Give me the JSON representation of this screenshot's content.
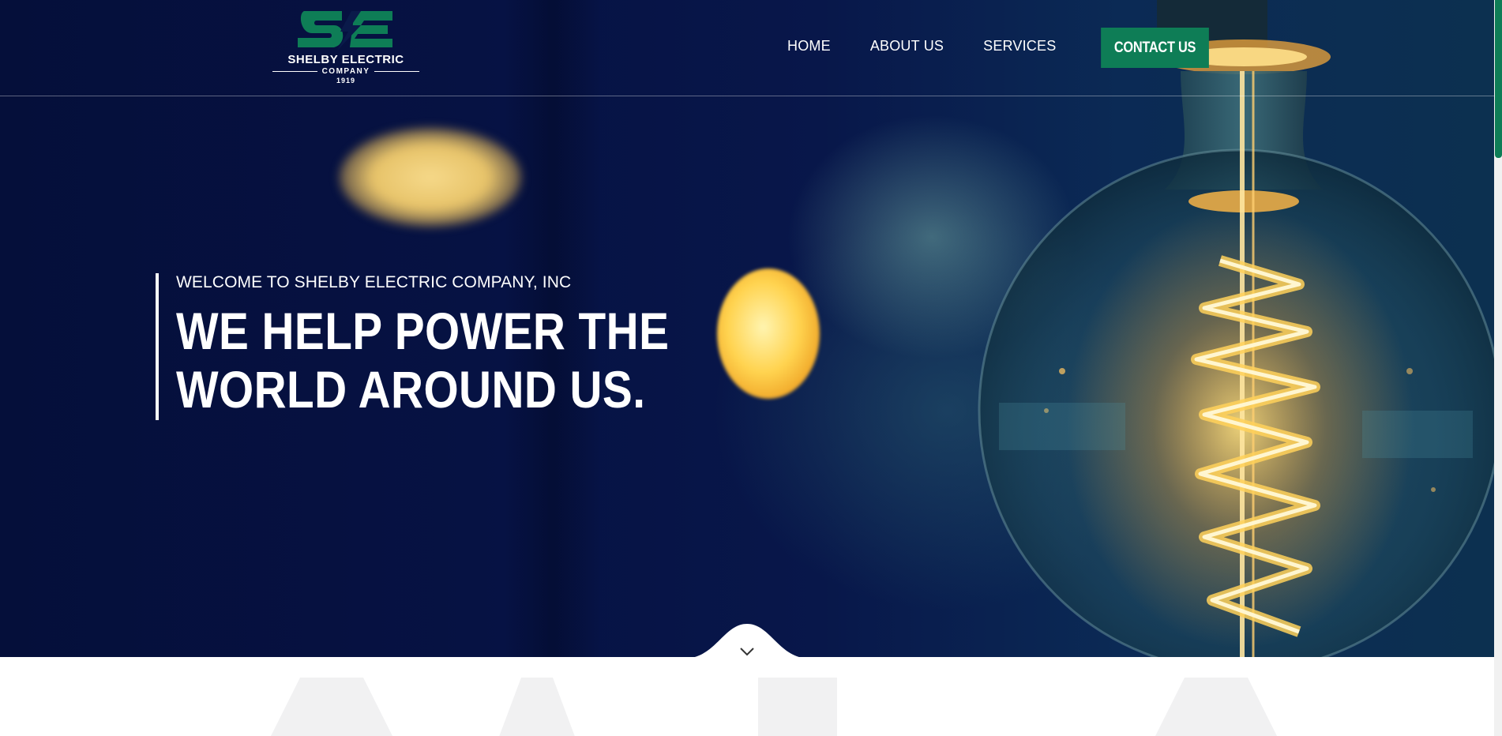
{
  "brand": {
    "logo_name": "SHELBY ELECTRIC",
    "logo_sub": "COMPANY",
    "logo_year": "1919",
    "accent_color": "#0e7d56"
  },
  "nav": {
    "items": [
      "HOME",
      "ABOUT US",
      "SERVICES"
    ],
    "contact_label": "CONTACT US"
  },
  "hero": {
    "kicker": "WELCOME TO SHELBY ELECTRIC COMPANY, INC",
    "headline_line1": "WE HELP POWER THE",
    "headline_line2": "WORLD AROUND US.",
    "scroll_icon": "chevron-down-icon"
  }
}
